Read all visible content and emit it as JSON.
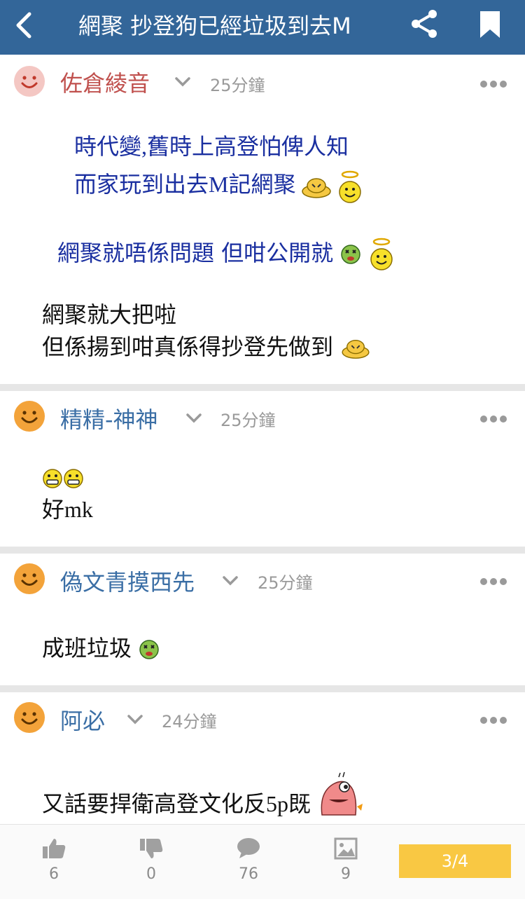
{
  "header": {
    "title": "網聚 抄登狗已經垃圾到去M",
    "icons": {
      "back": "back-arrow-icon",
      "share": "share-icon",
      "bookmark": "bookmark-icon"
    },
    "color": "#336699"
  },
  "posts": [
    {
      "username": "佐倉綾音",
      "time": "25分鐘",
      "username_color": "#c0504d",
      "avatar_color": "#f4c7c3",
      "lines": [
        "時代變,舊時上高登怕俾人知",
        "而家玩到出去M記網聚",
        "網聚就唔係問題 但咁公開就",
        "網聚就大把啦",
        "但係揚到咁真係得抄登先做到"
      ]
    },
    {
      "username": "精精-神神",
      "time": "25分鐘",
      "username_color": "#3a6ea5",
      "avatar_color": "#f3a33a",
      "lines": [
        "好mk"
      ]
    },
    {
      "username": "偽文青摸西先",
      "time": "25分鐘",
      "username_color": "#3a6ea5",
      "avatar_color": "#f3a33a",
      "lines": [
        "成班垃圾"
      ]
    },
    {
      "username": "阿必",
      "time": "24分鐘",
      "username_color": "#3a6ea5",
      "avatar_color": "#f3a33a",
      "lines": [
        "又話要捍衛高登文化反5p既"
      ]
    }
  ],
  "bottom": {
    "like_count": "6",
    "dislike_count": "0",
    "reply_count": "76",
    "image_count": "9",
    "page": "3/4",
    "icons": [
      "thumbs-up-icon",
      "thumbs-down-icon",
      "comment-icon",
      "image-icon"
    ]
  }
}
